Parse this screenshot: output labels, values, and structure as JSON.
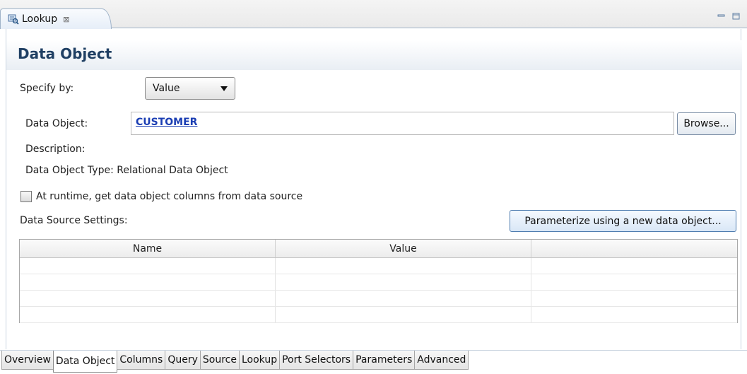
{
  "tab": {
    "label": "Lookup",
    "close_glyph": "⊠"
  },
  "header": {
    "title": "Data Object"
  },
  "specify_by": {
    "label": "Specify by:",
    "value": "Value"
  },
  "data_object": {
    "label": "Data Object:",
    "value": "CUSTOMER",
    "browse_label": "Browse..."
  },
  "description": {
    "label": "Description:"
  },
  "object_type": {
    "text": "Data Object Type: Relational Data Object"
  },
  "runtime_checkbox": {
    "label": "At runtime, get data object columns from data source",
    "checked": false
  },
  "data_source": {
    "label": "Data Source Settings:",
    "parameterize_label": "Parameterize using a new data object...",
    "columns": [
      "Name",
      "Value",
      ""
    ],
    "rows": [
      [
        "",
        "",
        ""
      ],
      [
        "",
        "",
        ""
      ],
      [
        "",
        "",
        ""
      ],
      [
        "",
        "",
        ""
      ]
    ]
  },
  "bottom_tabs": [
    "Overview",
    "Data Object",
    "Columns",
    "Query",
    "Source",
    "Lookup",
    "Port Selectors",
    "Parameters",
    "Advanced"
  ],
  "active_bottom_tab": "Data Object",
  "colors": {
    "title": "#1f3f63",
    "link": "#1a3db3",
    "tab_border": "#9fb3c9"
  },
  "icons": {
    "tab_icon": "lookup-transformation-icon",
    "minimize": "minimize-icon",
    "maximize": "maximize-icon",
    "dropdown": "chevron-down-icon"
  }
}
